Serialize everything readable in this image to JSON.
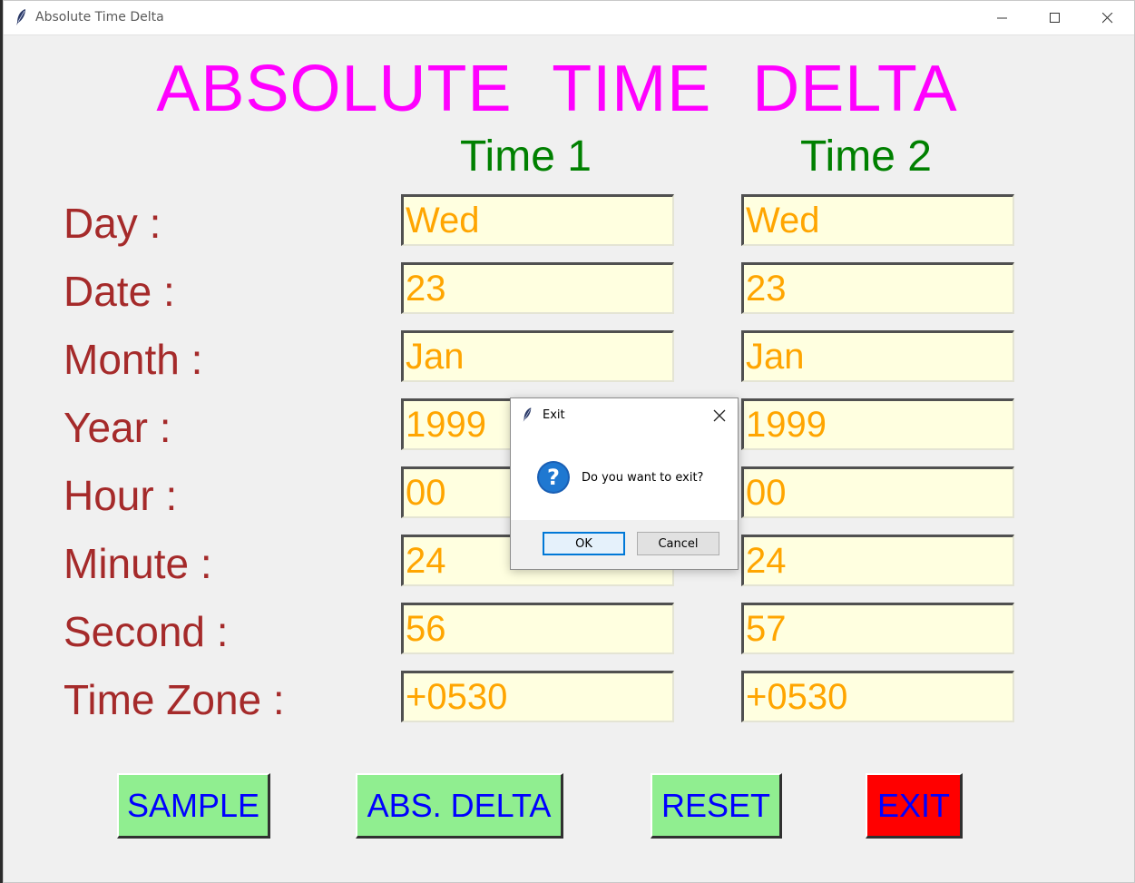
{
  "window": {
    "title": "Absolute Time Delta"
  },
  "app_title": "ABSOLUTE  TIME  DELTA",
  "columns": {
    "time1": "Time 1",
    "time2": "Time 2"
  },
  "rows": [
    {
      "label": "Day :",
      "time1": "Wed",
      "time2": "Wed"
    },
    {
      "label": "Date :",
      "time1": "23",
      "time2": "23"
    },
    {
      "label": "Month :",
      "time1": "Jan",
      "time2": "Jan"
    },
    {
      "label": "Year :",
      "time1": "1999",
      "time2": "1999"
    },
    {
      "label": "Hour :",
      "time1": "00",
      "time2": "00"
    },
    {
      "label": "Minute :",
      "time1": "24",
      "time2": "24"
    },
    {
      "label": "Second :",
      "time1": "56",
      "time2": "57"
    },
    {
      "label": "Time Zone :",
      "time1": "+0530",
      "time2": "+0530"
    }
  ],
  "buttons": {
    "sample": "SAMPLE",
    "abs_delta": "ABS. DELTA",
    "reset": "RESET",
    "exit": "EXIT"
  },
  "dialog": {
    "title": "Exit",
    "message": "Do you want to exit?",
    "ok": "OK",
    "cancel": "Cancel",
    "icon": "question-icon"
  },
  "colors": {
    "title": "#ff00ff",
    "column_header": "#008000",
    "row_label": "#a52a2a",
    "field_text": "#ffa500",
    "field_bg": "#ffffe0",
    "button_bg": "#90ee90",
    "button_text": "#0000ff",
    "exit_bg": "#ff0000"
  }
}
